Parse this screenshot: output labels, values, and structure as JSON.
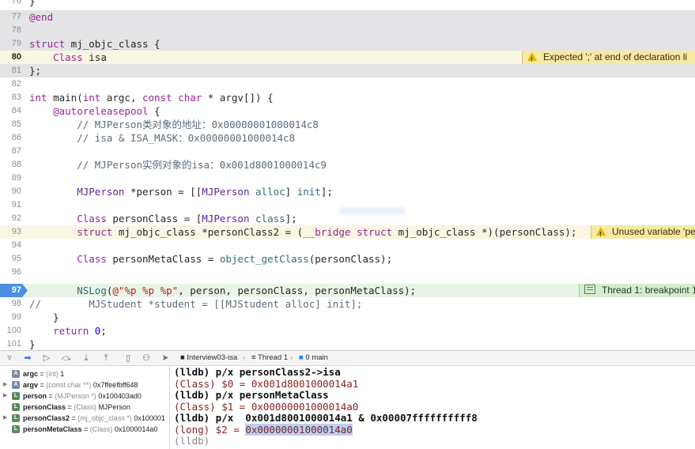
{
  "editor": {
    "lines": [
      {
        "n": "76",
        "t": "}"
      },
      {
        "n": "77",
        "t": "@end"
      },
      {
        "n": "78",
        "t": ""
      },
      {
        "n": "79",
        "t": "struct mj_objc_class {"
      },
      {
        "n": "80",
        "t": "    Class isa"
      },
      {
        "n": "81",
        "t": "};"
      },
      {
        "n": "82",
        "t": ""
      },
      {
        "n": "83",
        "t": "int main(int argc, const char * argv[]) {"
      },
      {
        "n": "84",
        "t": "    @autoreleasepool {"
      },
      {
        "n": "85",
        "t": "        // MJPerson类对象的地址：0x00000001000014c8"
      },
      {
        "n": "86",
        "t": "        // isa & ISA_MASK：0x00000001000014c8"
      },
      {
        "n": "87",
        "t": ""
      },
      {
        "n": "88",
        "t": "        // MJPerson实例对象的isa：0x001d8001000014c9"
      },
      {
        "n": "89",
        "t": ""
      },
      {
        "n": "90",
        "t": "        MJPerson *person = [[MJPerson alloc] init];"
      },
      {
        "n": "91",
        "t": ""
      },
      {
        "n": "92",
        "t": "        Class personClass = [MJPerson class];"
      },
      {
        "n": "93",
        "t": "        struct mj_objc_class *personClass2 = (__bridge struct mj_objc_class *)(personClass);"
      },
      {
        "n": "94",
        "t": ""
      },
      {
        "n": "95",
        "t": "        Class personMetaClass = object_getClass(personClass);"
      },
      {
        "n": "96",
        "t": ""
      },
      {
        "n": "97",
        "t": "        NSLog(@\"%p %p %p\", person, personClass, personMetaClass);"
      },
      {
        "n": "98",
        "t": "//        MJStudent *student = [[MJStudent alloc] init];"
      },
      {
        "n": "99",
        "t": "    }"
      },
      {
        "n": "100",
        "t": "    return 0;"
      },
      {
        "n": "101",
        "t": "}"
      }
    ],
    "issues": {
      "line80": "Expected ';' at end of declaration li",
      "line93": "Unused variable 'pe",
      "line97": "Thread 1: breakpoint 1"
    }
  },
  "debug_bar": {
    "scheme": "Interview03-isa",
    "thread": "Thread 1",
    "frame": "0 main"
  },
  "variables": [
    {
      "name": "argc",
      "type": "(int)",
      "value": "1"
    },
    {
      "name": "argv",
      "type": "(const char **)",
      "value": "0x7ffeefbff648"
    },
    {
      "name": "person",
      "type": "(MJPerson *)",
      "value": "0x100403ad0"
    },
    {
      "name": "personClass",
      "type": "(Class)",
      "value": "MJPerson"
    },
    {
      "name": "personClass2",
      "type": "(mj_objc_class *)",
      "value": "0x100001"
    },
    {
      "name": "personMetaClass",
      "type": "(Class)",
      "value": "0x1000014a0"
    }
  ],
  "console": {
    "l1": "(lldb) p/x personClass2->isa",
    "l2": "(Class) $0 = 0x001d8001000014a1",
    "l3": "(lldb) p/x personMetaClass",
    "l4": "(Class) $1 = 0x00000001000014a0",
    "l5": "(lldb) p/x  0x001d8001000014a1 & 0x00007ffffffffff8",
    "l6_prefix": "(long) $2 = ",
    "l6_selected": "0x00000001000014a0",
    "l7": "(lldb)"
  }
}
